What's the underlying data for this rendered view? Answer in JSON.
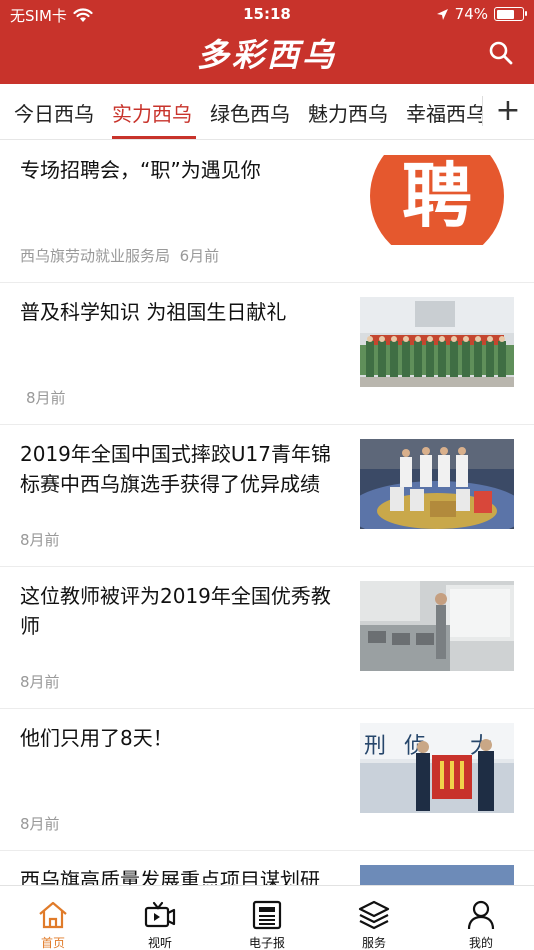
{
  "status_bar": {
    "carrier": "无SIM卡",
    "time": "15:18",
    "battery": "74%",
    "battery_level": 0.74
  },
  "header": {
    "title": "多彩西乌"
  },
  "tabs": [
    "今日西乌",
    "实力西乌",
    "绿色西乌",
    "魅力西乌",
    "幸福西乌"
  ],
  "active_tab": "实力西乌",
  "plus_label": "+",
  "articles": [
    {
      "title": "专场招聘会，“职”为遇见你",
      "source": "西乌旗劳动就业服务局",
      "time": "6月前",
      "thumb_text": "聘"
    },
    {
      "title": "普及科学知识 为祖国生日献礼",
      "time": "8月前"
    },
    {
      "title": "2019年全国中国式摔跤U17青年锦标赛中西乌旗选手获得了优异成绩",
      "time": "8月前"
    },
    {
      "title": "这位教师被评为2019年全国优秀教师",
      "time": "8月前"
    },
    {
      "title": "他们只用了8天！",
      "time": "8月前"
    },
    {
      "title": "西乌旗高质量发展重点项目谋划研"
    }
  ],
  "tabbar": {
    "home": "首页",
    "video": "视听",
    "epaper": "电子报",
    "service": "服务",
    "mine": "我的"
  }
}
